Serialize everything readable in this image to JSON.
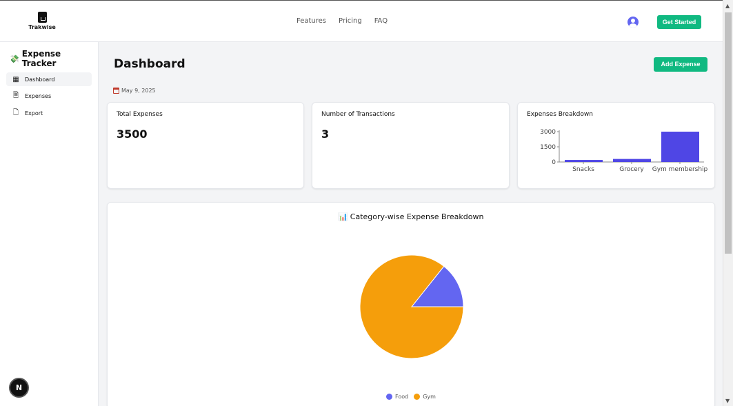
{
  "brand": {
    "name": "Trakwise"
  },
  "nav": {
    "links": [
      "Features",
      "Pricing",
      "FAQ"
    ],
    "cta": "Get Started"
  },
  "sidebar": {
    "title": "Expense Tracker",
    "items": [
      {
        "label": "Dashboard",
        "icon": "grid-icon",
        "active": true
      },
      {
        "label": "Expenses",
        "icon": "document-icon",
        "active": false
      },
      {
        "label": "Export",
        "icon": "file-export-icon",
        "active": false
      }
    ],
    "badge": "N"
  },
  "main": {
    "title": "Dashboard",
    "add_button": "Add Expense",
    "date": "May 9, 2025",
    "cards": {
      "total_label": "Total Expenses",
      "total_value": "3500",
      "count_label": "Number of Transactions",
      "count_value": "3",
      "breakdown_label": "Expenses Breakdown"
    },
    "pie_title": "Category-wise Expense Breakdown"
  },
  "colors": {
    "accent": "#10b981",
    "bar": "#4f46e5",
    "food": "#6366f1",
    "gym": "#f59e0b"
  },
  "chart_data": [
    {
      "type": "bar",
      "title": "Expenses Breakdown",
      "categories": [
        "Snacks",
        "Grocery",
        "Gym membership"
      ],
      "values": [
        200,
        300,
        3000
      ],
      "yticks": [
        0,
        1500,
        3000
      ],
      "ylim": [
        0,
        3000
      ]
    },
    {
      "type": "pie",
      "title": "Category-wise Expense Breakdown",
      "categories": [
        "Food",
        "Gym"
      ],
      "values": [
        500,
        3000
      ],
      "legend": "bottom"
    }
  ]
}
